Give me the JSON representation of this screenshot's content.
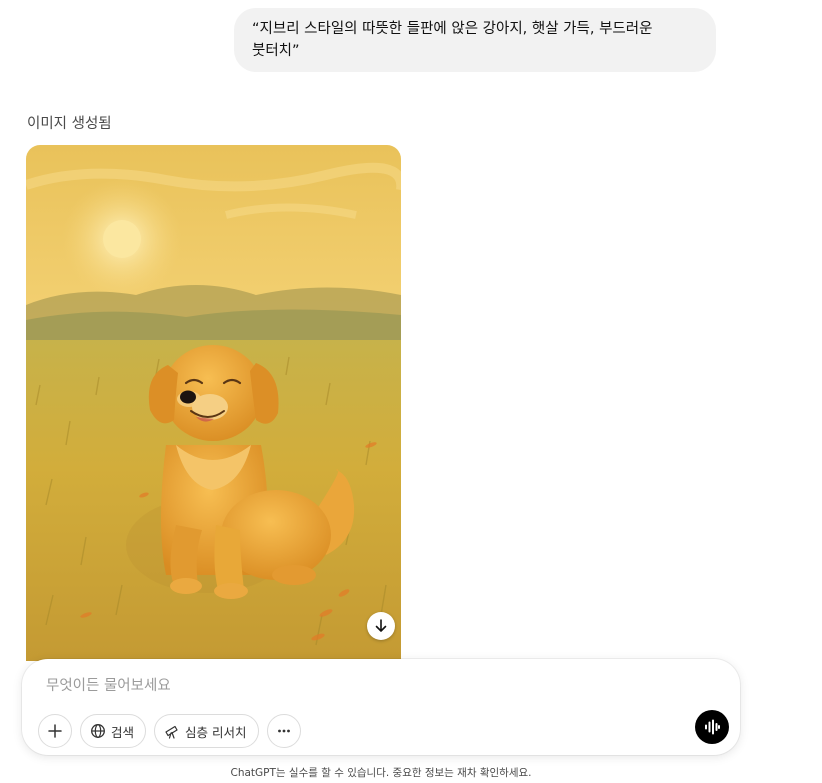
{
  "user_message": {
    "line1": "“지브리 스타일의 따뜻한 들판에 앉은 강아지, 햇살 가득, 부드러운",
    "line2": "붓터치”"
  },
  "assistant": {
    "status": "이미지 생성됨",
    "image": {
      "subject": "golden puppy sitting in a sunny meadow",
      "download_icon": "arrow-down-icon"
    }
  },
  "composer": {
    "placeholder": "무엇이든 물어보세요",
    "add_icon": "plus-icon",
    "search_label": "검색",
    "search_icon": "globe-icon",
    "research_label": "심층 리서치",
    "research_icon": "telescope-icon",
    "more_icon": "ellipsis-icon",
    "voice_icon": "voice-waveform-icon"
  },
  "footer": {
    "disclaimer": "ChatGPT는 실수를 할 수 있습니다. 중요한 정보는 재차 확인하세요."
  },
  "colors": {
    "bubble_bg": "#f2f2f2",
    "voice_button_bg": "#000000",
    "image_sky": "#f4cf68",
    "image_grass": "#c9a83a",
    "dog_fur": "#e9a73a"
  }
}
